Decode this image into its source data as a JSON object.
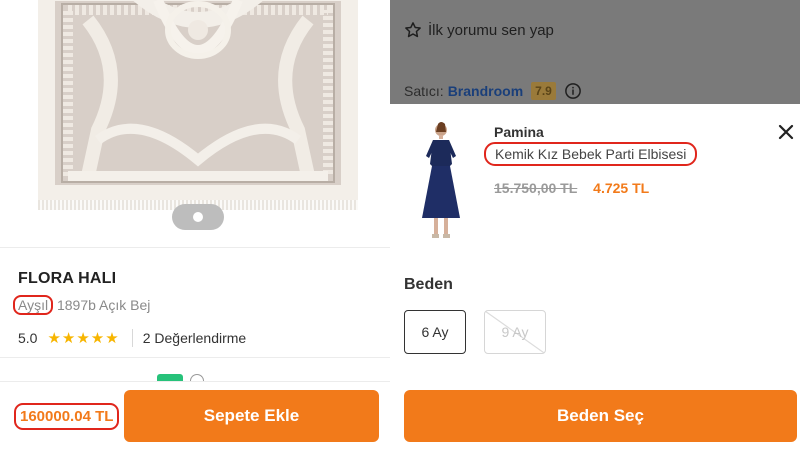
{
  "left": {
    "brand": "FLORA HALI",
    "subtitle_highlight": "Ayşıl",
    "subtitle_rest": " 1897b Açık Bej",
    "rating": "5.0",
    "stars": "★★★★★",
    "review_count": "2 Değerlendirme",
    "price": "160000.04 TL",
    "add_to_cart_label": "Sepete Ekle"
  },
  "right": {
    "first_review_label": "İlk yorumu sen yap",
    "seller_label": "Satıcı:",
    "seller_name": "Brandroom",
    "seller_score": "7.9",
    "product_brand": "Pamina",
    "product_name": "Kemik Kız Bebek Parti Elbisesi",
    "old_price": "15.750,00 TL",
    "new_price": "4.725 TL",
    "size_label": "Beden",
    "sizes": [
      {
        "label": "6 Ay",
        "available": true
      },
      {
        "label": "9 Ay",
        "available": false
      }
    ],
    "select_size_label": "Beden Seç"
  },
  "colors": {
    "accent": "#f27a1a",
    "highlight_red": "#e0261c",
    "star": "#f7b500",
    "seller_link": "#1a3f7a"
  }
}
